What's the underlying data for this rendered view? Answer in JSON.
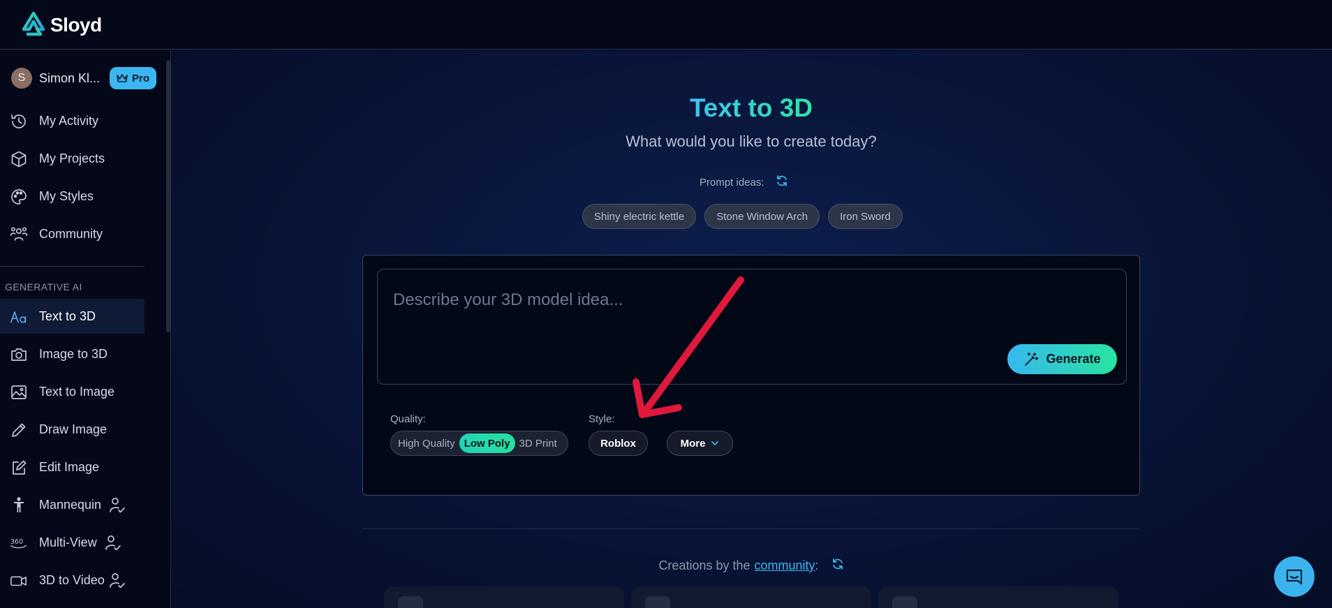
{
  "app": {
    "brand": "Sloyd"
  },
  "user": {
    "initial": "S",
    "name": "Simon Kl...",
    "badge": "Pro"
  },
  "sidebar": {
    "items": [
      {
        "label": "My Activity",
        "icon": "history-icon"
      },
      {
        "label": "My Projects",
        "icon": "cube-icon"
      },
      {
        "label": "My Styles",
        "icon": "palette-icon"
      },
      {
        "label": "Community",
        "icon": "users-icon"
      }
    ],
    "section_label": "GENERATIVE AI",
    "gen_items": [
      {
        "label": "Text to 3D",
        "icon": "text-aa-icon",
        "active": true
      },
      {
        "label": "Image to 3D",
        "icon": "camera-icon"
      },
      {
        "label": "Text to Image",
        "icon": "image-icon"
      },
      {
        "label": "Draw Image",
        "icon": "pencil-icon"
      },
      {
        "label": "Edit Image",
        "icon": "edit-icon"
      },
      {
        "label": "Mannequin",
        "icon": "mannequin-icon",
        "extra_icon": "user-check-icon"
      },
      {
        "label": "Multi-View",
        "icon": "360-icon",
        "extra_icon": "user-check-icon"
      },
      {
        "label": "3D to Video",
        "icon": "video-icon",
        "extra_icon": "user-check-icon"
      }
    ]
  },
  "main": {
    "title": "Text to 3D",
    "subtitle": "What would you like to create today?",
    "prompt_ideas_label": "Prompt ideas:",
    "prompt_chips": [
      "Shiny electric kettle",
      "Stone Window Arch",
      "Iron Sword"
    ],
    "input": {
      "placeholder": "Describe your 3D model idea..."
    },
    "generate_label": "Generate",
    "quality": {
      "label": "Quality:",
      "options": [
        "High Quality",
        "Low Poly",
        "3D Print"
      ],
      "selected": "Low Poly"
    },
    "style": {
      "label": "Style:",
      "selected": "Roblox",
      "more_label": "More"
    },
    "community": {
      "prefix": "Creations by the",
      "link": "community",
      "suffix": ":"
    }
  },
  "colors": {
    "accent_blue": "#3bb6f0",
    "accent_green": "#2ee3a6",
    "annotation_arrow": "#e0183c",
    "background": "#050a1e"
  }
}
